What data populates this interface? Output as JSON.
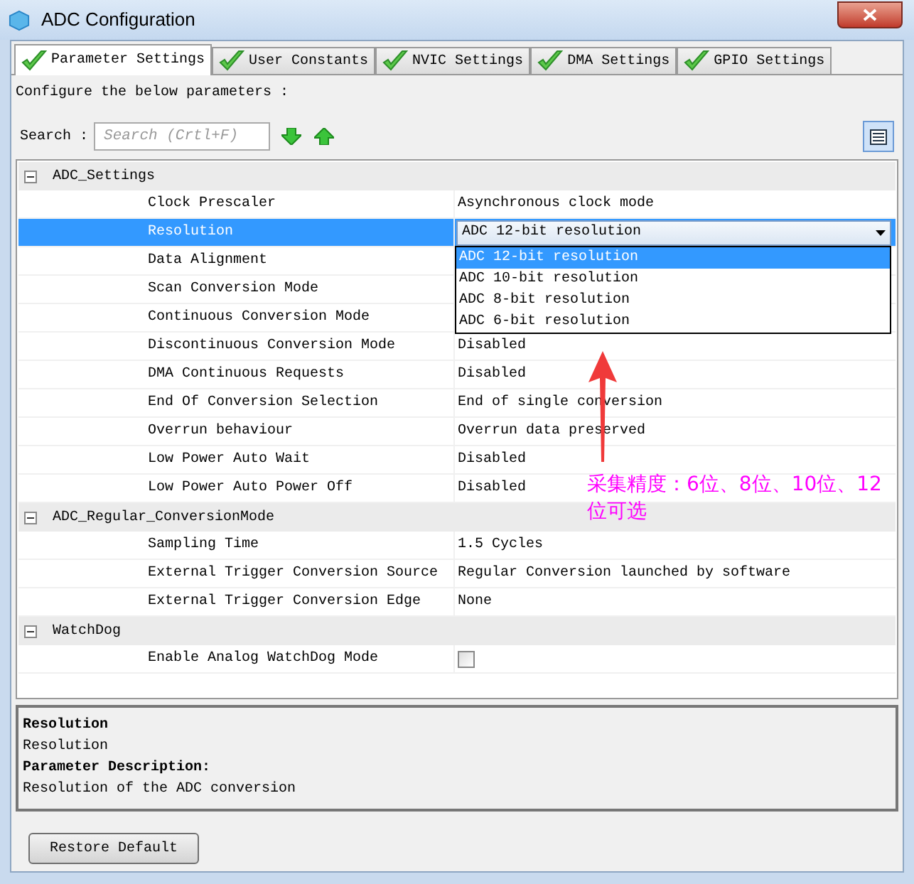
{
  "window": {
    "title": "ADC Configuration"
  },
  "tabs": [
    {
      "label": "Parameter Settings",
      "selected": true
    },
    {
      "label": "User Constants",
      "selected": false
    },
    {
      "label": "NVIC Settings",
      "selected": false
    },
    {
      "label": "DMA Settings",
      "selected": false
    },
    {
      "label": "GPIO Settings",
      "selected": false
    }
  ],
  "intro": "Configure the below parameters :",
  "search": {
    "label": "Search :",
    "placeholder": "Search (Crtl+F)"
  },
  "groups": [
    {
      "name": "ADC_Settings",
      "expanded": true,
      "rows": [
        {
          "name": "Clock Prescaler",
          "kind": "text",
          "value": "Asynchronous clock mode",
          "selected": false
        },
        {
          "name": "Resolution",
          "kind": "combo",
          "value": "ADC 12-bit resolution",
          "selected": true
        },
        {
          "name": "Data Alignment",
          "kind": "none",
          "selected": false
        },
        {
          "name": "Scan Conversion Mode",
          "kind": "none",
          "selected": false
        },
        {
          "name": "Continuous Conversion Mode",
          "kind": "none",
          "selected": false
        },
        {
          "name": "Discontinuous Conversion Mode",
          "kind": "text",
          "value": "Disabled",
          "selected": false
        },
        {
          "name": "DMA Continuous Requests",
          "kind": "text",
          "value": "Disabled",
          "selected": false
        },
        {
          "name": "End Of Conversion Selection",
          "kind": "text",
          "value": "End of single conversion",
          "selected": false
        },
        {
          "name": "Overrun behaviour",
          "kind": "text",
          "value": "Overrun data preserved",
          "selected": false
        },
        {
          "name": "Low Power Auto Wait",
          "kind": "text",
          "value": "Disabled",
          "selected": false
        },
        {
          "name": "Low Power Auto Power Off",
          "kind": "text",
          "value": "Disabled",
          "selected": false
        }
      ]
    },
    {
      "name": "ADC_Regular_ConversionMode",
      "expanded": true,
      "rows": [
        {
          "name": "Sampling Time",
          "kind": "text",
          "value": "1.5 Cycles",
          "selected": false
        },
        {
          "name": "External Trigger Conversion Source",
          "kind": "text",
          "value": "Regular Conversion launched by software",
          "selected": false
        },
        {
          "name": "External Trigger Conversion Edge",
          "kind": "text",
          "value": "None",
          "selected": false
        }
      ]
    },
    {
      "name": "WatchDog",
      "expanded": true,
      "rows": [
        {
          "name": "Enable Analog WatchDog Mode",
          "kind": "checkbox",
          "checked": false,
          "selected": false
        }
      ]
    }
  ],
  "dropdown": {
    "options": [
      {
        "label": "ADC 12-bit resolution",
        "selected": true
      },
      {
        "label": "ADC 10-bit resolution",
        "selected": false
      },
      {
        "label": "ADC 8-bit resolution",
        "selected": false
      },
      {
        "label": "ADC 6-bit resolution",
        "selected": false
      }
    ]
  },
  "annotation": {
    "lines": [
      "采集精度：6位、8位、10位、12",
      "位可选"
    ]
  },
  "description": {
    "title": "Resolution",
    "name": "Resolution",
    "heading": "Parameter Description:",
    "text": "Resolution of the ADC conversion"
  },
  "buttons": [
    {
      "label": "Restore Default"
    }
  ]
}
